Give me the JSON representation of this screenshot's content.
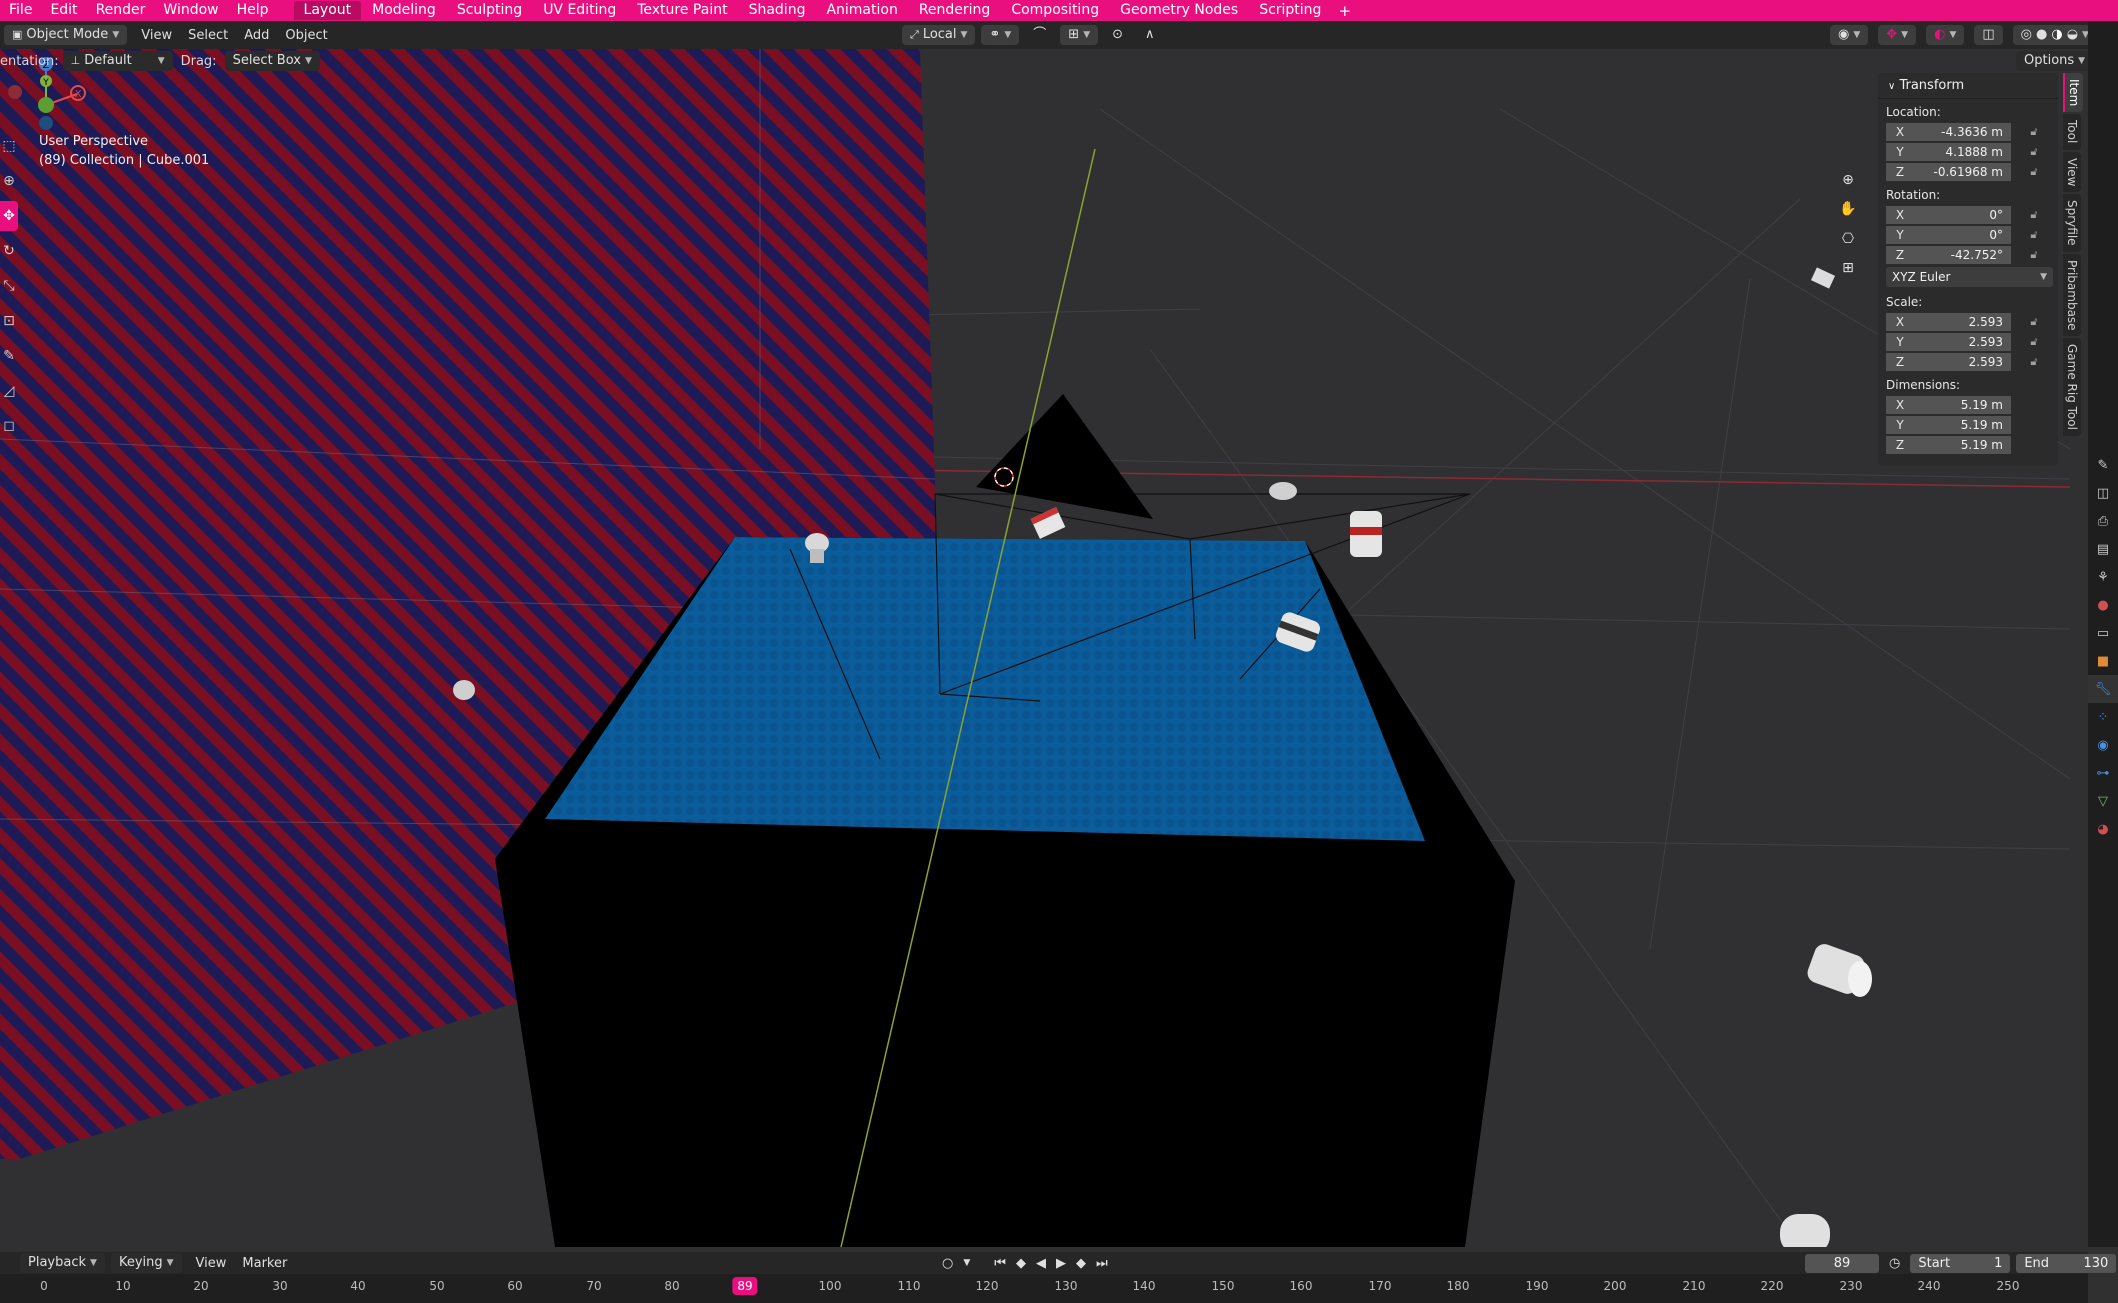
{
  "menubar": {
    "items": [
      "File",
      "Edit",
      "Render",
      "Window",
      "Help"
    ],
    "workspaces": [
      "Layout",
      "Modeling",
      "Sculpting",
      "UV Editing",
      "Texture Paint",
      "Shading",
      "Animation",
      "Rendering",
      "Compositing",
      "Geometry Nodes",
      "Scripting"
    ],
    "active_workspace": "Layout",
    "add_label": "+"
  },
  "header": {
    "mode": "Object Mode",
    "menus": [
      "View",
      "Select",
      "Add",
      "Object"
    ],
    "transform_space": "Local",
    "options": "Options"
  },
  "header2": {
    "orientation_label": "entation:",
    "orientation_value": "Default",
    "drag_label": "Drag:",
    "drag_value": "Select Box"
  },
  "viewport": {
    "perspective": "User Perspective",
    "collection": "(89) Collection | Cube.001"
  },
  "gizmo": {
    "x": "X",
    "y": "Y",
    "z": "Z"
  },
  "npanel": {
    "title": "Transform",
    "location_label": "Location:",
    "location": [
      {
        "axis": "X",
        "value": "-4.3636 m"
      },
      {
        "axis": "Y",
        "value": "4.1888 m"
      },
      {
        "axis": "Z",
        "value": "-0.61968 m"
      }
    ],
    "rotation_label": "Rotation:",
    "rotation": [
      {
        "axis": "X",
        "value": "0°"
      },
      {
        "axis": "Y",
        "value": "0°"
      },
      {
        "axis": "Z",
        "value": "-42.752°"
      }
    ],
    "rotation_mode": "XYZ Euler",
    "scale_label": "Scale:",
    "scale": [
      {
        "axis": "X",
        "value": "2.593"
      },
      {
        "axis": "Y",
        "value": "2.593"
      },
      {
        "axis": "Z",
        "value": "2.593"
      }
    ],
    "dimensions_label": "Dimensions:",
    "dimensions": [
      {
        "axis": "X",
        "value": "5.19 m"
      },
      {
        "axis": "Y",
        "value": "5.19 m"
      },
      {
        "axis": "Z",
        "value": "5.19 m"
      }
    ]
  },
  "sidetabs": [
    "Item",
    "Tool",
    "View",
    "Spryfile",
    "Pribambase",
    "Game Rig Tool"
  ],
  "timeline": {
    "menus": [
      "Playback",
      "Keying",
      "View",
      "Marker"
    ],
    "current_frame": "89",
    "start_label": "Start",
    "start_value": "1",
    "end_label": "End",
    "end_value": "130",
    "ticks": [
      "0",
      "10",
      "20",
      "30",
      "40",
      "50",
      "60",
      "70",
      "80",
      "89",
      "100",
      "110",
      "120",
      "130",
      "140",
      "150",
      "160",
      "170",
      "180",
      "190",
      "200",
      "210",
      "220",
      "230",
      "240",
      "250"
    ]
  },
  "colors": {
    "accent": "#ea0f7f",
    "background": "#303030",
    "water": "#0b5c9a",
    "red_stripe": "#7a0f24",
    "navy_stripe": "#1e1a55"
  }
}
